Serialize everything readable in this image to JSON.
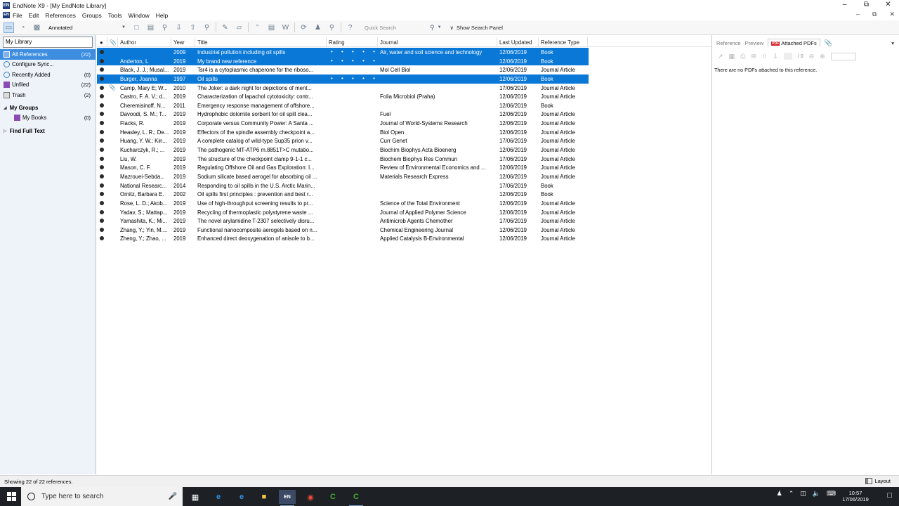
{
  "window": {
    "title": "EndNote X9 - [My EndNote Library]"
  },
  "menu": [
    "File",
    "Edit",
    "References",
    "Groups",
    "Tools",
    "Window",
    "Help"
  ],
  "toolbar": {
    "style": "Annotated",
    "search_placeholder": "Quick Search",
    "show_search_panel": "Show Search Panel"
  },
  "library": {
    "header": "My Library",
    "groups": [
      {
        "label": "All References",
        "count": "(22)",
        "selected": true,
        "icon": "all-references-icon"
      },
      {
        "label": "Configure Sync...",
        "count": "",
        "icon": "sync-icon"
      },
      {
        "label": "Recently Added",
        "count": "(0)",
        "icon": "recently-added-icon"
      },
      {
        "label": "Unfiled",
        "count": "(22)",
        "icon": "unfiled-icon"
      },
      {
        "label": "Trash",
        "count": "(2)",
        "icon": "trash-icon"
      }
    ],
    "my_groups": {
      "label": "My Groups",
      "items": [
        {
          "label": "My Books",
          "count": "(0)"
        }
      ]
    },
    "find_full_text": "Find Full Text"
  },
  "columns": {
    "author": "Author",
    "year": "Year",
    "title": "Title",
    "rating": "Rating",
    "journal": "Journal",
    "last_updated": "Last Updated",
    "reference_type": "Reference Type"
  },
  "references": [
    {
      "author": "",
      "year": "2009",
      "title": "Industrial pollution including oil spills",
      "journal": "Air, water and soil science and technology",
      "updated": "12/06/2019",
      "type": "Book",
      "selected": true,
      "rating": true
    },
    {
      "author": "Anderton, L",
      "year": "2019",
      "title": "My brand new reference",
      "journal": "",
      "updated": "12/06/2019",
      "type": "Book",
      "selected": true,
      "rating": true
    },
    {
      "author": "Black, J. J.; Musal...",
      "year": "2019",
      "title": "Tsr4 is a cytoplasmic chaperone for the riboso...",
      "journal": "Mol Cell Biol",
      "updated": "12/06/2019",
      "type": "Journal Article"
    },
    {
      "author": "Burger, Joanna",
      "year": "1997",
      "title": "Oil spills",
      "journal": "",
      "updated": "12/06/2019",
      "type": "Book",
      "selected": true,
      "rating": true
    },
    {
      "author": "Camp, Mary E; W...",
      "year": "2010",
      "title": "The Joker: a dark night for depictions of ment...",
      "journal": "",
      "updated": "17/06/2019",
      "type": "Journal Article",
      "attachment": true
    },
    {
      "author": "Castro, F. A. V.; d...",
      "year": "2019",
      "title": "Characterization of lapachol cytotoxicity: contr...",
      "journal": "Folia Microbiol (Praha)",
      "updated": "12/06/2019",
      "type": "Journal Article"
    },
    {
      "author": "Cheremisinoff, N...",
      "year": "2011",
      "title": "Emergency response management of offshore...",
      "journal": "",
      "updated": "12/06/2019",
      "type": "Book"
    },
    {
      "author": "Davoodi, S. M.; T...",
      "year": "2019",
      "title": "Hydrophobic dolomite sorbent for oil spill clea...",
      "journal": "Fuel",
      "updated": "12/06/2019",
      "type": "Journal Article"
    },
    {
      "author": "Flacks, R.",
      "year": "2019",
      "title": "Corporate versus Community Power: A Santa ...",
      "journal": "Journal of World-Systems Research",
      "updated": "12/06/2019",
      "type": "Journal Article"
    },
    {
      "author": "Heasley, L. R.; De...",
      "year": "2019",
      "title": "Effectors of the spindle assembly checkpoint a...",
      "journal": "Biol Open",
      "updated": "12/06/2019",
      "type": "Journal Article"
    },
    {
      "author": "Huang, Y. W.; Kin...",
      "year": "2019",
      "title": "A complete catalog of wild-type Sup35 prion v...",
      "journal": "Curr Genet",
      "updated": "17/06/2019",
      "type": "Journal Article"
    },
    {
      "author": "Kucharczyk, R.; ...",
      "year": "2019",
      "title": "The pathogenic MT-ATP6 m.8851T>C mutatio...",
      "journal": "Biochim Biophys Acta Bioenerg",
      "updated": "12/06/2019",
      "type": "Journal Article"
    },
    {
      "author": "Liu, W.",
      "year": "2019",
      "title": "The structure of the checkpoint clamp 9-1-1 c...",
      "journal": "Biochem Biophys Res Commun",
      "updated": "17/06/2019",
      "type": "Journal Article"
    },
    {
      "author": "Mason, C. F.",
      "year": "2019",
      "title": "Regulating Offshore Oil and Gas Exploration: I...",
      "journal": "Review of Environmental Economics and ...",
      "updated": "12/06/2019",
      "type": "Journal Article"
    },
    {
      "author": "Mazrouei-Sebda...",
      "year": "2019",
      "title": "Sodium silicate based aerogel for absorbing oil ...",
      "journal": "Materials Research Express",
      "updated": "12/06/2019",
      "type": "Journal Article"
    },
    {
      "author": "National Researc...",
      "year": "2014",
      "title": "Responding to oil spills in the U.S. Arctic Marin...",
      "journal": "",
      "updated": "17/06/2019",
      "type": "Book"
    },
    {
      "author": "Ornitz, Barbara E.",
      "year": "2002",
      "title": "Oil spills first principles : prevention and best r...",
      "journal": "",
      "updated": "12/06/2019",
      "type": "Book"
    },
    {
      "author": "Rose, L. D.; Akob...",
      "year": "2019",
      "title": "Use of high-throughput screening results to pr...",
      "journal": "Science of the Total Environment",
      "updated": "12/06/2019",
      "type": "Journal Article"
    },
    {
      "author": "Yadav, S.; Mattap...",
      "year": "2019",
      "title": "Recycling of thermoplastic polystyrene waste ...",
      "journal": "Journal of Applied Polymer Science",
      "updated": "12/06/2019",
      "type": "Journal Article"
    },
    {
      "author": "Yamashita, K.; Mi...",
      "year": "2019",
      "title": "The novel arylamidine T-2307 selectively disru...",
      "journal": "Antimicrob Agents Chemother",
      "updated": "17/06/2019",
      "type": "Journal Article"
    },
    {
      "author": "Zhang, Y.; Yin, M....",
      "year": "2019",
      "title": "Functional nanocomposite aerogels based on n...",
      "journal": "Chemical Engineering Journal",
      "updated": "12/06/2019",
      "type": "Journal Article"
    },
    {
      "author": "Zheng, Y.; Zhao, ...",
      "year": "2019",
      "title": "Enhanced direct deoxygenation of anisole to b...",
      "journal": "Applied Catalysis B-Environmental",
      "updated": "12/06/2019",
      "type": "Journal Article"
    }
  ],
  "right_panel": {
    "tabs": [
      "Reference",
      "Preview",
      "Attached PDFs"
    ],
    "pdf_badge": "PDF",
    "page_count": "/ 0",
    "message": "There are no PDFs attached to this reference."
  },
  "status": {
    "text": "Showing 22 of 22 references.",
    "layout": "Layout"
  },
  "taskbar": {
    "search_placeholder": "Type here to search",
    "time": "10:57",
    "date": "17/06/2019"
  }
}
